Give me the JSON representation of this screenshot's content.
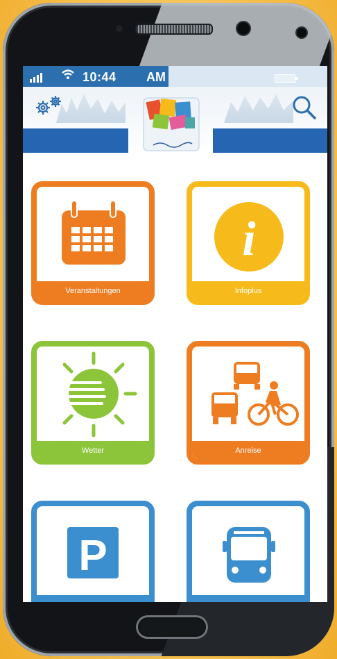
{
  "status_bar": {
    "time": "10:44",
    "ampm": "AM"
  },
  "tiles": [
    {
      "label": "Veranstaltungen",
      "icon": "calendar-icon",
      "color": "#ee7d22"
    },
    {
      "label": "Infoplus",
      "icon": "info-icon",
      "color": "#f6bb1a"
    },
    {
      "label": "Wetter",
      "icon": "weather-sun-icon",
      "color": "#8cc43a"
    },
    {
      "label": "Anreise",
      "icon": "travel-icon",
      "color": "#ee7d22"
    },
    {
      "label": "",
      "icon": "parking-icon",
      "color": "#3b8fce"
    },
    {
      "label": "",
      "icon": "bus-icon",
      "color": "#3b8fce"
    }
  ],
  "colors": {
    "header_blue": "#2565b2",
    "background": "#f5c04a"
  }
}
